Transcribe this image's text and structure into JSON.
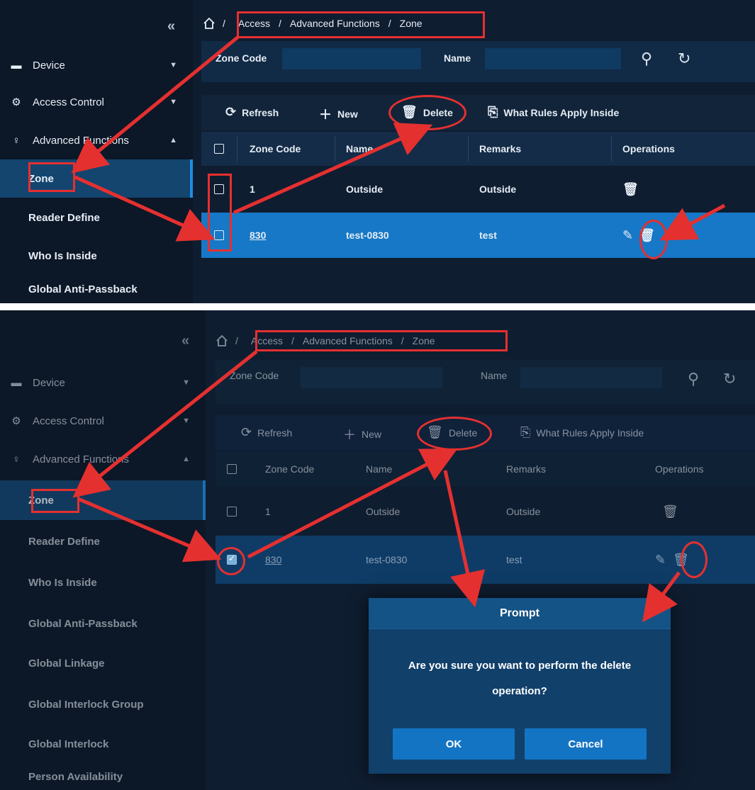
{
  "nav": {
    "collapse_glyph": "«",
    "device": "Device",
    "access_control": "Access Control",
    "advanced_functions": "Advanced Functions",
    "sub_items_top": [
      "Zone",
      "Reader Define",
      "Who Is Inside",
      "Global Anti-Passback"
    ],
    "sub_items_bottom": [
      "Zone",
      "Reader Define",
      "Who Is Inside",
      "Global Anti-Passback",
      "Global Linkage",
      "Global Interlock Group",
      "Global Interlock",
      "Person Availability"
    ]
  },
  "breadcrumb": {
    "sep_home": "/",
    "access": "Access",
    "sep": "/",
    "advanced": "Advanced Functions",
    "zone": "Zone"
  },
  "search": {
    "zone_code_label": "Zone Code",
    "name_label": "Name"
  },
  "toolbar": {
    "refresh": "Refresh",
    "new": "New",
    "delete": "Delete",
    "rules": "What Rules Apply Inside"
  },
  "table": {
    "headers": {
      "code": "Zone Code",
      "name": "Name",
      "remarks": "Remarks",
      "operations": "Operations"
    },
    "rows": [
      {
        "code": "1",
        "name": "Outside",
        "remarks": "Outside"
      },
      {
        "code": "830",
        "name": "test-0830",
        "remarks": "test"
      }
    ]
  },
  "dialog": {
    "title": "Prompt",
    "message": "Are you sure you want to perform the delete operation?",
    "ok": "OK",
    "cancel": "Cancel"
  },
  "colors": {
    "highlight": "#e53030",
    "selected_row": "#1678c6",
    "sidebar_active": "#13456f"
  },
  "icons": [
    "home-icon",
    "search-icon",
    "reset-icon",
    "refresh-icon",
    "plus-icon",
    "trash-icon",
    "rules-search-icon",
    "edit-icon",
    "device-icon",
    "gear-icon",
    "advanced-functions-icon"
  ]
}
